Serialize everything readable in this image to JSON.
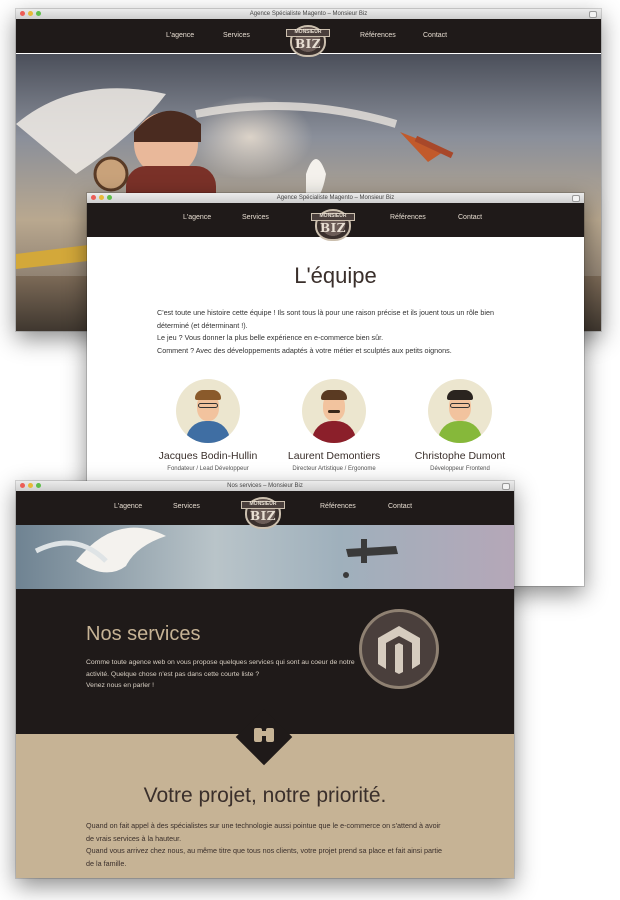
{
  "window1": {
    "title": "Agence Spécialiste Magento – Monsieur Biz",
    "nav": [
      "L'agence",
      "Services",
      "Références",
      "Contact"
    ]
  },
  "window2": {
    "title": "Agence Spécialiste Magento – Monsieur Biz",
    "nav": [
      "L'agence",
      "Services",
      "Références",
      "Contact"
    ],
    "heading": "L'équipe",
    "paragraphs": [
      "C'est toute une histoire cette équipe ! Ils sont tous là pour une raison précise et ils jouent tous un rôle bien déterminé (et déterminant !).",
      "Le jeu ? Vous donner la plus belle expérience en e-commerce bien sûr.",
      "Comment ? Avec des développements adaptés à votre métier et sculptés aux petits oignons."
    ],
    "members": [
      {
        "name": "Jacques Bodin-Hullin",
        "role": "Fondateur / Lead Développeur"
      },
      {
        "name": "Laurent Demontiers",
        "role": "Directeur Artistique / Ergonome"
      },
      {
        "name": "Christophe Dumont",
        "role": "Développeur Frontend"
      }
    ]
  },
  "window3": {
    "title": "Nos services – Monsieur Biz",
    "nav": [
      "L'agence",
      "Services",
      "Références",
      "Contact"
    ],
    "services_heading": "Nos services",
    "services_paragraphs": [
      "Comme toute agence web on vous propose quelques services qui sont au coeur de notre activité. Quelque chose n'est pas dans cette courte liste ?",
      "Venez nous en parler !"
    ],
    "project_heading": "Votre projet, notre priorité.",
    "project_paragraphs": [
      "Quand on fait appel à des spécialistes sur une technologie aussi pointue que le e-commerce on s'attend à avoir de vrais services à la hauteur.",
      "Quand vous arrivez chez nous, au même titre que tous nos clients, votre projet prend sa place et fait ainsi partie de la famille."
    ]
  },
  "logo": {
    "top": "MONSIEUR",
    "word": "BIZ"
  },
  "colors": {
    "dark": "#1f1a19",
    "tan": "#c6b395",
    "text": "#3a2f2b"
  },
  "icons": [
    "magento-icon",
    "binoculars-icon"
  ]
}
